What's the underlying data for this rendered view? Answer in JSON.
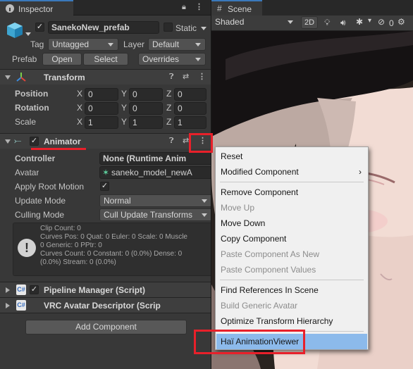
{
  "inspector": {
    "tab_label": "Inspector",
    "object_name": "SanekoNew_prefab",
    "static_label": "Static",
    "tag_label": "Tag",
    "tag_value": "Untagged",
    "layer_label": "Layer",
    "layer_value": "Default",
    "prefab_label": "Prefab",
    "open_label": "Open",
    "select_label": "Select",
    "overrides_label": "Overrides"
  },
  "transform": {
    "title": "Transform",
    "rows": [
      {
        "label": "Position",
        "x": "0",
        "y": "0",
        "z": "0"
      },
      {
        "label": "Rotation",
        "x": "0",
        "y": "0",
        "z": "0"
      },
      {
        "label": "Scale",
        "x": "1",
        "y": "1",
        "z": "1"
      }
    ],
    "axis_x": "X",
    "axis_y": "Y",
    "axis_z": "Z"
  },
  "animator": {
    "title": "Animator",
    "controller_label": "Controller",
    "controller_value": "None (Runtime Anim",
    "avatar_label": "Avatar",
    "avatar_value": "saneko_model_newA",
    "apply_root_motion_label": "Apply Root Motion",
    "update_mode_label": "Update Mode",
    "update_mode_value": "Normal",
    "culling_mode_label": "Culling Mode",
    "culling_mode_value": "Cull Update Transforms",
    "info_lines": [
      "Clip Count: 0",
      "Curves Pos: 0 Quat: 0 Euler: 0 Scale: 0 Muscle",
      "0 Generic: 0 PPtr: 0",
      "Curves Count: 0 Constant: 0 (0.0%) Dense: 0",
      "(0.0%) Stream: 0 (0.0%)"
    ]
  },
  "components": {
    "pipeline_manager": "Pipeline Manager (Script)",
    "vrc_avatar_descriptor": "VRC Avatar Descriptor (Scrip",
    "add_component_label": "Add Component"
  },
  "scene": {
    "tab_label": "Scene",
    "shading_mode": "Shaded",
    "mode_2d": "2D",
    "gizmo_count": "0"
  },
  "context_menu": {
    "items": [
      {
        "label": "Reset",
        "enabled": true
      },
      {
        "label": "Modified Component",
        "enabled": true,
        "submenu": true
      },
      {
        "label": "Remove Component",
        "enabled": true
      },
      {
        "label": "Move Up",
        "enabled": false
      },
      {
        "label": "Move Down",
        "enabled": true
      },
      {
        "label": "Copy Component",
        "enabled": true
      },
      {
        "label": "Paste Component As New",
        "enabled": false
      },
      {
        "label": "Paste Component Values",
        "enabled": false
      },
      {
        "label": "Find References In Scene",
        "enabled": true
      },
      {
        "label": "Build Generic Avatar",
        "enabled": false
      },
      {
        "label": "Optimize Transform Hierarchy",
        "enabled": true
      },
      {
        "label": "Haï AnimationViewer",
        "enabled": true,
        "highlighted": true
      }
    ]
  },
  "colors": {
    "highlight_box": "#e8202a",
    "menu_highlight": "#8cbaeb",
    "tab_accent": "#3a79bb"
  }
}
